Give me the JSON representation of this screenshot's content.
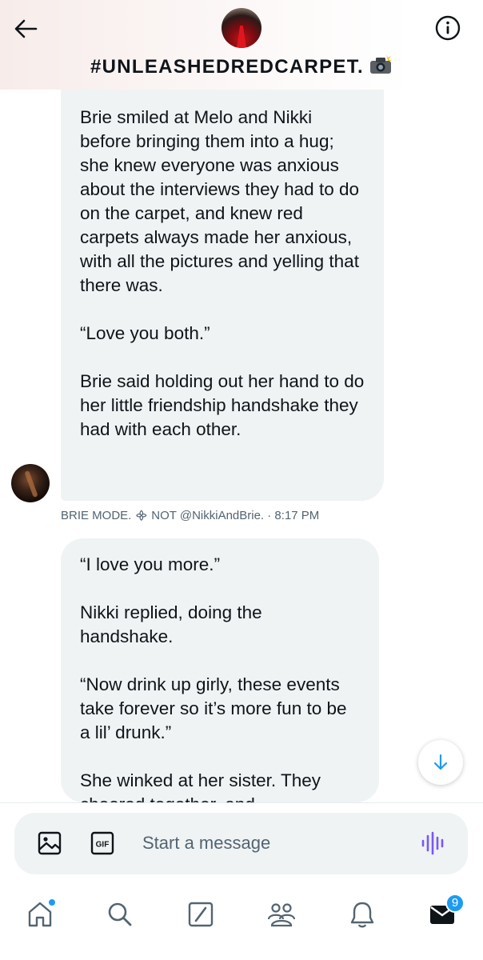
{
  "header": {
    "title": "#UNLEASHEDREDCARPET.",
    "title_emoji": "📸",
    "back_icon": "arrow-left-icon",
    "info_icon": "info-icon"
  },
  "messages": [
    {
      "paragraphs": [
        "Brie smiled at Melo and Nikki before bringing them into a hug; she knew everyone was anxious about the interviews they had to do on the carpet, and knew red carpets always made her anxious, with all the pictures and yelling that there was.",
        "“Love you both.”",
        "Brie said holding out her hand to do her little friendship handshake they had with each other."
      ],
      "meta": "BRIE MODE. ᯽ NOT @NikkiAndBrie. · 8:17 PM"
    },
    {
      "paragraphs": [
        "“I love you more.”",
        "Nikki replied, doing the handshake.",
        "“Now drink up girly, these events take forever so it’s more fun to be a lil’ drunk.”",
        "She winked at her sister. They cheered together, and"
      ]
    }
  ],
  "composer": {
    "placeholder": "Start a message",
    "gif_label": "GIF"
  },
  "nav": {
    "items": [
      "home-icon",
      "search-icon",
      "grok-icon",
      "communities-icon",
      "notifications-icon",
      "messages-icon"
    ],
    "messages_badge": "9"
  },
  "colors": {
    "accent": "#1d9bf0",
    "bubble": "#eff3f4",
    "voice": "#7856ff",
    "meta_text": "#536471"
  }
}
